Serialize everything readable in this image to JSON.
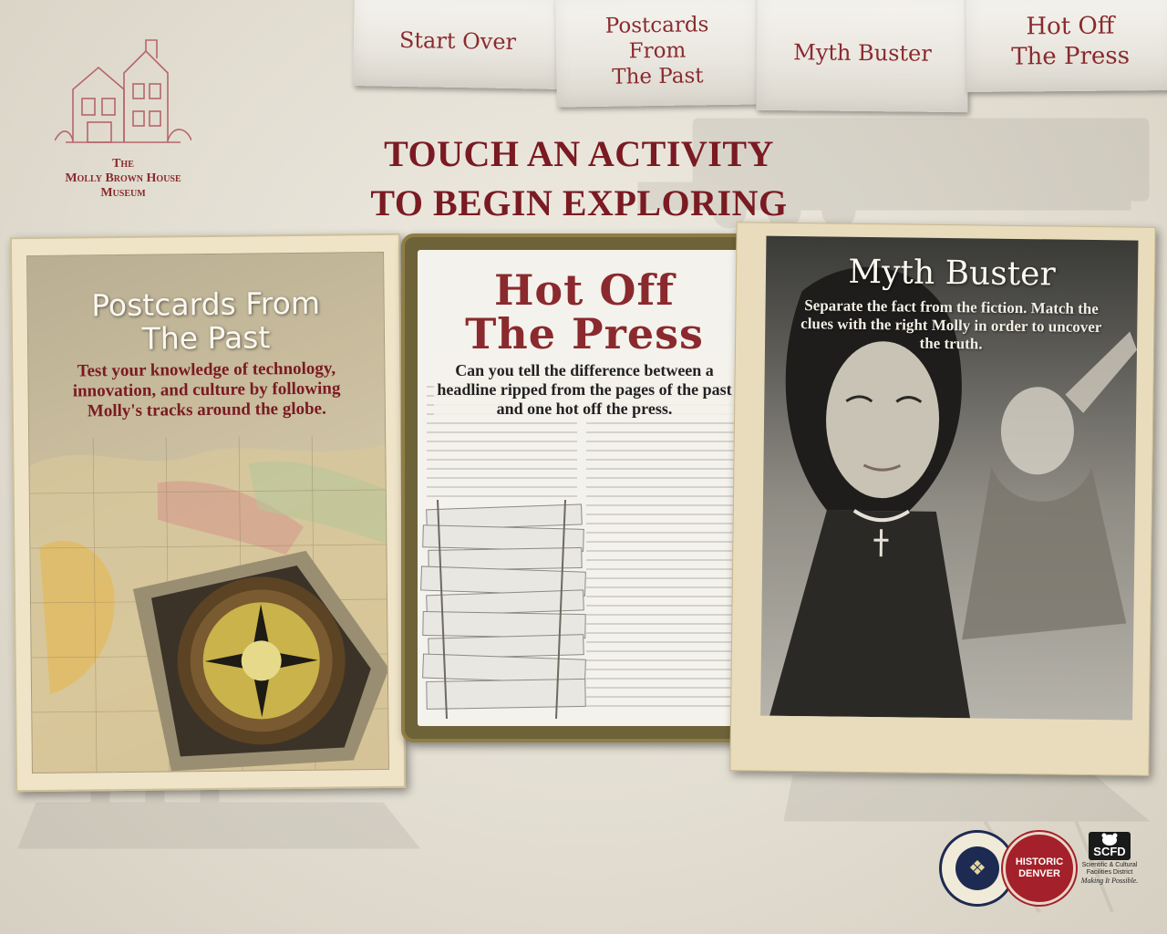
{
  "museum": {
    "name_line1": "The",
    "name_line2": "Molly Brown House",
    "name_line3": "Museum"
  },
  "nav": {
    "start_over": "Start Over",
    "postcards": "Postcards\nFrom\nThe Past",
    "myth_buster": "Myth Buster",
    "hot_off_press": "Hot Off\nThe Press"
  },
  "heading": "TOUCH AN ACTIVITY\nTO BEGIN EXPLORING",
  "activities": {
    "postcards": {
      "title": "Postcards From\nThe Past",
      "description": "Test your knowledge of technology, innovation, and culture by following Molly's tracks around the globe."
    },
    "hot_off_press": {
      "title": "Hot Off\nThe Press",
      "description": "Can you tell the difference between a headline ripped from the pages of the past and one hot off the press."
    },
    "myth_buster": {
      "title": "Myth Buster",
      "description": "Separate the fact from the fiction. Match the clues with the right Molly in order to uncover the truth."
    }
  },
  "partners": {
    "historic_top": "HISTORIC",
    "historic_bottom": "DENVER",
    "scfd": "SCFD",
    "scfd_sub": "Scientific & Cultural Facilities District",
    "scfd_tag": "Making It Possible."
  },
  "colors": {
    "brand_red": "#8a2a2e",
    "heading_red": "#7a1a22",
    "paper": "#efece3"
  }
}
